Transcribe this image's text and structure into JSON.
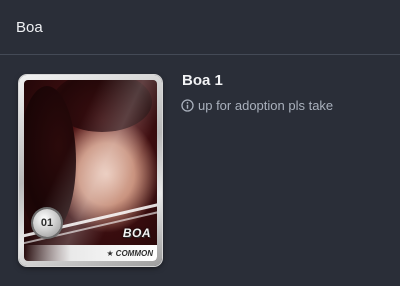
{
  "header": {
    "title": "Boa"
  },
  "card": {
    "number": "01",
    "name": "BOA",
    "rarity": "COMMON",
    "rarity_icon": "star-icon"
  },
  "details": {
    "title": "Boa 1",
    "description": "up for adoption pls take",
    "description_icon": "info-icon"
  }
}
